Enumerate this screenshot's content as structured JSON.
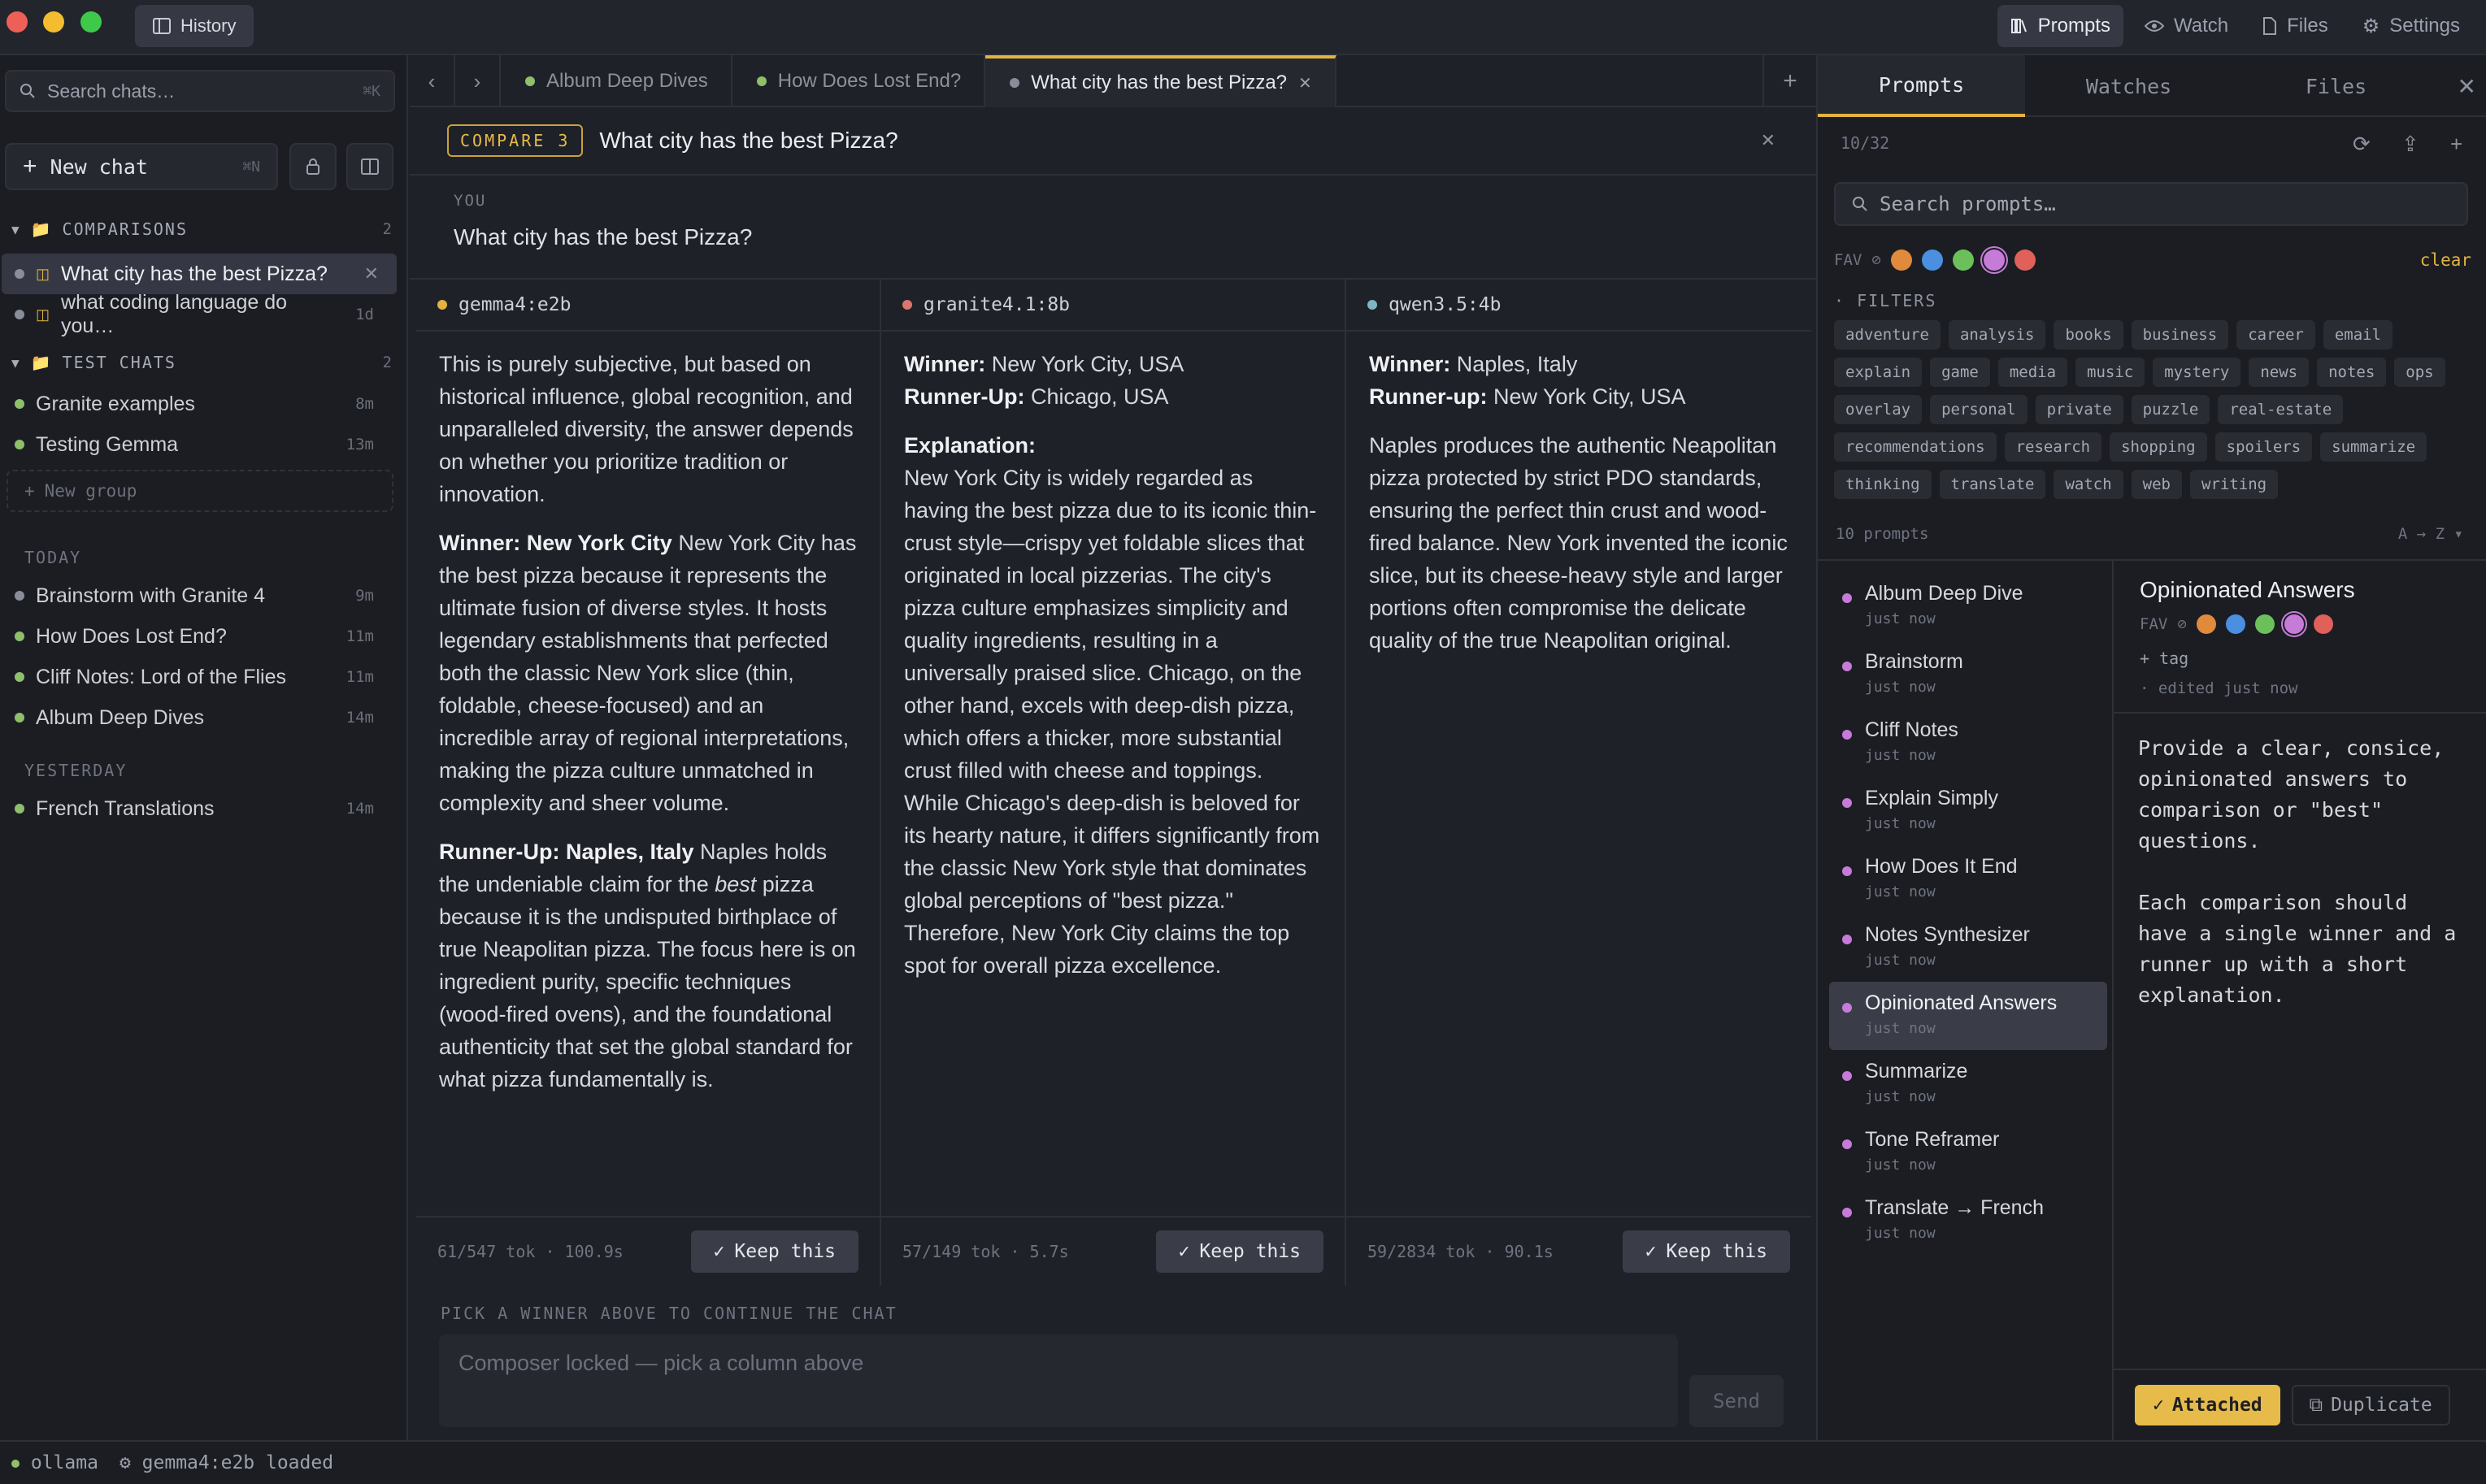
{
  "titlebar": {
    "history_label": "History",
    "tabs": [
      {
        "label": "Prompts"
      },
      {
        "label": "Watch"
      },
      {
        "label": "Files"
      },
      {
        "label": "Settings"
      }
    ]
  },
  "colors": {
    "accent": "#e2b341",
    "traffic_red": "#ee5f58",
    "traffic_yellow": "#f3bd2f",
    "traffic_green": "#3fc94a"
  },
  "sidebar": {
    "search_placeholder": "Search chats…",
    "search_shortcut": "⌘K",
    "new_chat_label": "New chat",
    "new_chat_shortcut": "⌘N",
    "groups": [
      {
        "name": "COMPARISONS",
        "count": "2"
      },
      {
        "name": "TEST CHATS",
        "count": "2"
      }
    ],
    "comparison_items": [
      {
        "label": "What city has the best Pizza?"
      },
      {
        "label": "what coding language do you…",
        "age": "1d"
      }
    ],
    "test_items": [
      {
        "label": "Granite examples",
        "age": "8m"
      },
      {
        "label": "Testing Gemma",
        "age": "13m"
      }
    ],
    "new_group_label": "New group",
    "today_label": "TODAY",
    "today_items": [
      {
        "label": "Brainstorm with Granite 4",
        "age": "9m"
      },
      {
        "label": "How Does Lost End?",
        "age": "11m"
      },
      {
        "label": "Cliff Notes: Lord of the Flies",
        "age": "11m"
      },
      {
        "label": "Album Deep Dives",
        "age": "14m"
      }
    ],
    "yesterday_label": "YESTERDAY",
    "yesterday_items": [
      {
        "label": "French Translations",
        "age": "14m"
      }
    ]
  },
  "main": {
    "tabs": [
      {
        "label": "Album Deep Dives"
      },
      {
        "label": "How Does Lost End?"
      },
      {
        "label": "What city has the best Pizza?"
      }
    ],
    "compare_badge": "COMPARE 3",
    "compare_title": "What city has the best Pizza?",
    "you_label": "YOU",
    "you_text": "What city has the best Pizza?",
    "columns": [
      {
        "model": "gemma4:e2b",
        "dot": "#e2b341",
        "p1": "This is purely subjective, but based on historical influence, global recognition, and unparalleled diversity, the answer depends on whether you prioritize tradition or innovation.",
        "winner_label": "Winner: New York City",
        "winner_text": " New York City has the best pizza because it represents the ultimate fusion of diverse styles. It hosts legendary establishments that perfected both the classic New York slice (thin, foldable, cheese-focused) and an incredible array of regional interpretations, making the pizza culture unmatched in complexity and sheer volume.",
        "runner_label": "Runner-Up: Naples, Italy",
        "runner_a": " Naples holds the undeniable claim for the ",
        "runner_em": "best",
        "runner_b": " pizza because it is the undisputed birthplace of true Neapolitan pizza. The focus here is on ingredient purity, specific techniques (wood-fired ovens), and the foundational authenticity that set the global standard for what pizza fundamentally is.",
        "tokens": "61/547 tok · 100.9s",
        "keep": "Keep this"
      },
      {
        "model": "granite4.1:8b",
        "dot": "#d9776f",
        "winner_label": "Winner:",
        "winner_text": " New York City, USA",
        "runner_label": "Runner-Up:",
        "runner_text": " Chicago, USA",
        "expl_label": "Explanation:",
        "expl_text": "New York City is widely regarded as having the best pizza due to its iconic thin-crust style—crispy yet foldable slices that originated in local pizzerias. The city's pizza culture emphasizes simplicity and quality ingredients, resulting in a universally praised slice. Chicago, on the other hand, excels with deep-dish pizza, which offers a thicker, more substantial crust filled with cheese and toppings. While Chicago's deep-dish is beloved for its hearty nature, it differs significantly from the classic New York style that dominates global perceptions of \"best pizza.\" Therefore, New York City claims the top spot for overall pizza excellence.",
        "tokens": "57/149 tok · 5.7s",
        "keep": "Keep this"
      },
      {
        "model": "qwen3.5:4b",
        "dot": "#7fb6c4",
        "winner_label": "Winner:",
        "winner_text": " Naples, Italy",
        "runner_label": "Runner-up:",
        "runner_text": " New York City, USA",
        "body": "Naples produces the authentic Neapolitan pizza protected by strict PDO standards, ensuring the perfect thin crust and wood-fired balance. New York invented the iconic slice, but its cheese-heavy style and larger portions often compromise the delicate quality of the true Neapolitan original.",
        "tokens": "59/2834 tok · 90.1s",
        "keep": "Keep this"
      }
    ],
    "pick_label": "PICK A WINNER ABOVE TO CONTINUE THE CHAT",
    "composer_placeholder": "Composer locked — pick a column above",
    "send_label": "Send"
  },
  "right": {
    "tabs": [
      {
        "label": "Prompts"
      },
      {
        "label": "Watches"
      },
      {
        "label": "Files"
      }
    ],
    "counter": "10/32",
    "search_placeholder": "Search prompts…",
    "fav_label": "FAV",
    "clear_label": "clear",
    "fav_colors": [
      "#e08a3c",
      "#4a8fe0",
      "#6cc05a",
      "#c77bd8",
      "#e0605a"
    ],
    "filters_label": "FILTERS",
    "tags": [
      "adventure",
      "analysis",
      "books",
      "business",
      "career",
      "email",
      "explain",
      "game",
      "media",
      "music",
      "mystery",
      "news",
      "notes",
      "ops",
      "overlay",
      "personal",
      "private",
      "puzzle",
      "real-estate",
      "recommendations",
      "research",
      "shopping",
      "spoilers",
      "summarize",
      "thinking",
      "translate",
      "watch",
      "web",
      "writing"
    ],
    "prompt_count": "10 prompts",
    "sort_label": "A → Z ▾",
    "prompts": [
      {
        "name": "Album Deep Dive",
        "meta": "just now"
      },
      {
        "name": "Brainstorm",
        "meta": "just now"
      },
      {
        "name": "Cliff Notes",
        "meta": "just now"
      },
      {
        "name": "Explain Simply",
        "meta": "just now"
      },
      {
        "name": "How Does It End",
        "meta": "just now"
      },
      {
        "name": "Notes Synthesizer",
        "meta": "just now"
      },
      {
        "name": "Opinionated Answers",
        "meta": "just now"
      },
      {
        "name": "Summarize",
        "meta": "just now"
      },
      {
        "name": "Tone Reframer",
        "meta": "just now"
      },
      {
        "name": "Translate → French",
        "meta": "just now"
      }
    ],
    "detail": {
      "title": "Opinionated Answers",
      "fav_label": "FAV",
      "tag_label": "+ tag",
      "edited": "· edited just now",
      "body": "Provide a clear, consice, opinionated answers to comparison or \"best\" questions.\n\nEach comparison should have a single winner and a runner up with a short explanation.",
      "attached_label": "Attached",
      "duplicate_label": "Duplicate"
    }
  },
  "status": {
    "backend": "ollama",
    "model": "gemma4:e2b loaded"
  }
}
